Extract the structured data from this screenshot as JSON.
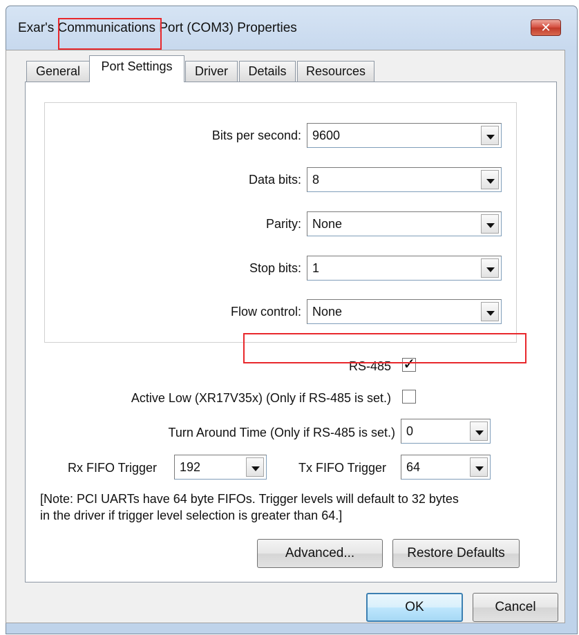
{
  "window": {
    "title": "Exar's Communications Port (COM3) Properties",
    "close_glyph": "✕"
  },
  "tabs": [
    {
      "label": "General"
    },
    {
      "label": "Port Settings"
    },
    {
      "label": "Driver"
    },
    {
      "label": "Details"
    },
    {
      "label": "Resources"
    }
  ],
  "settings": {
    "bits_per_second": {
      "label": "Bits per second:",
      "value": "9600"
    },
    "data_bits": {
      "label": "Data bits:",
      "value": "8"
    },
    "parity": {
      "label": "Parity:",
      "value": "None"
    },
    "stop_bits": {
      "label": "Stop bits:",
      "value": "1"
    },
    "flow_control": {
      "label": "Flow control:",
      "value": "None"
    }
  },
  "rs485": {
    "label": "RS-485",
    "checked": true,
    "check_glyph": "✓"
  },
  "active_low": {
    "label": "Active Low (XR17V35x) (Only if RS-485 is set.)",
    "checked": false
  },
  "turn_around": {
    "label": "Turn Around Time (Only if RS-485 is set.)",
    "value": "0"
  },
  "rx_fifo": {
    "label": "Rx FIFO Trigger",
    "value": "192"
  },
  "tx_fifo": {
    "label": "Tx FIFO Trigger",
    "value": "64"
  },
  "note": {
    "line1": "[Note: PCI UARTs have 64 byte FIFOs. Trigger levels will default to 32 bytes",
    "line2": "in the driver if trigger level selection is greater than 64.]"
  },
  "buttons": {
    "advanced": "Advanced...",
    "restore_defaults": "Restore Defaults",
    "ok": "OK",
    "cancel": "Cancel"
  },
  "colors": {
    "annotation": "#e8272b",
    "title_gradient": "#c8d9ee",
    "close_button": "#d34a3b"
  }
}
